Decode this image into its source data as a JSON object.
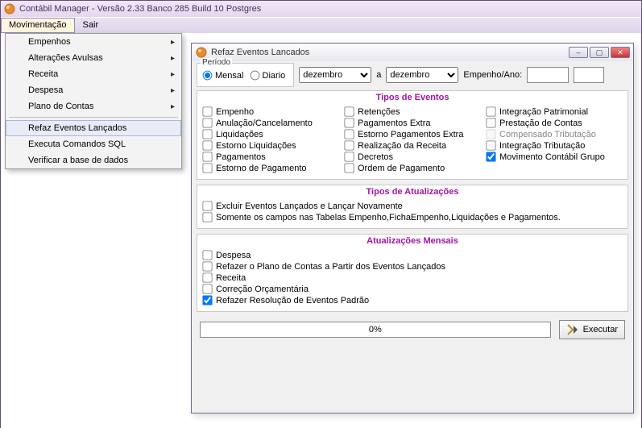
{
  "window": {
    "title": "Contábil Manager - Versão 2.33 Banco 285 Build 10 Postgres"
  },
  "menubar": {
    "items": [
      {
        "label": "Movimentação",
        "active": true
      },
      {
        "label": "Sair",
        "active": false
      }
    ]
  },
  "dropdown": {
    "items": [
      {
        "label": "Empenhos",
        "submenu": true
      },
      {
        "label": "Alterações Avulsas",
        "submenu": true
      },
      {
        "label": "Receita",
        "submenu": true
      },
      {
        "label": "Despesa",
        "submenu": true
      },
      {
        "label": "Plano de Contas",
        "submenu": true
      },
      {
        "label": "Refaz Eventos Lançados",
        "submenu": false,
        "highlight": true
      },
      {
        "label": "Executa Comandos SQL",
        "submenu": false
      },
      {
        "label": "Verificar a base de dados",
        "submenu": false
      }
    ]
  },
  "child": {
    "title": "Refaz Eventos Lancados",
    "periodo": {
      "legend": "Período",
      "mensal": "Mensal",
      "diario": "Diario",
      "selected": "mensal"
    },
    "month_from": "dezembro",
    "between_label": "a",
    "month_to": "dezembro",
    "empenho_ano_label": "Empenho/Ano:",
    "empenho_value": "",
    "ano_value": "",
    "tipos_eventos": {
      "legend": "Tipos de Eventos",
      "col1": [
        {
          "label": "Empenho",
          "checked": false
        },
        {
          "label": "Anulação/Cancelamento",
          "checked": false
        },
        {
          "label": "Liquidações",
          "checked": false
        },
        {
          "label": "Estorno Liquidações",
          "checked": false
        },
        {
          "label": "Pagamentos",
          "checked": false
        },
        {
          "label": "Estorno de Pagamento",
          "checked": false
        }
      ],
      "col2": [
        {
          "label": "Retenções",
          "checked": false
        },
        {
          "label": "Pagamentos Extra",
          "checked": false
        },
        {
          "label": "Estorno Pagamentos Extra",
          "checked": false
        },
        {
          "label": "Realização da Receita",
          "checked": false
        },
        {
          "label": "Decretos",
          "checked": false
        },
        {
          "label": "Ordem de Pagamento",
          "checked": false
        }
      ],
      "col3": [
        {
          "label": "Integração Patrimonial",
          "checked": false,
          "disabled": false
        },
        {
          "label": "Prestação de Contas",
          "checked": false,
          "disabled": false
        },
        {
          "label": "Compensado Tributação",
          "checked": false,
          "disabled": true
        },
        {
          "label": "Integração Tributação",
          "checked": false,
          "disabled": false
        },
        {
          "label": "Movimento Contábil Grupo",
          "checked": true,
          "disabled": false
        }
      ]
    },
    "tipos_atualizacoes": {
      "legend": "Tipos de Atualizações",
      "items": [
        {
          "label": "Excluir Eventos Lançados e Lançar Novamente",
          "checked": false
        },
        {
          "label": "Somente os campos nas Tabelas Empenho,FichaEmpenho,Liquidações e Pagamentos.",
          "checked": false
        }
      ]
    },
    "atualizacoes_mensais": {
      "legend": "Atualizações Mensais",
      "items": [
        {
          "label": "Despesa",
          "checked": false
        },
        {
          "label": "Refazer o Plano de Contas a Partir dos Eventos Lançados",
          "checked": false
        },
        {
          "label": "Receita",
          "checked": false
        },
        {
          "label": "Correção Orçamentária",
          "checked": false
        },
        {
          "label": "Refazer Resolução de Eventos Padrão",
          "checked": true
        }
      ]
    },
    "progress_label": "0%",
    "execute_label": "Executar"
  }
}
